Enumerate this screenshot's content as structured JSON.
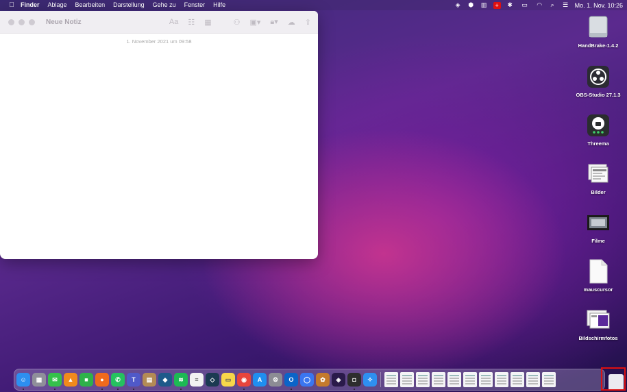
{
  "menubar": {
    "app_name": "Finder",
    "items": [
      "Ablage",
      "Bearbeiten",
      "Darstellung",
      "Gehe zu",
      "Fenster",
      "Hilfe"
    ],
    "clock": "Mo. 1. Nov.  10:26"
  },
  "note": {
    "title": "Neue Notiz",
    "format_label": "Aa",
    "date": "1. November 2021 um 09:58"
  },
  "desktop_icons": [
    {
      "label": "HandBrake-1.4.2",
      "icon": "disk-image-icon"
    },
    {
      "label": "OBS-Studio 27.1.3",
      "icon": "obs-icon"
    },
    {
      "label": "Threema",
      "icon": "threema-icon"
    },
    {
      "label": "Bilder",
      "icon": "folder-images-icon"
    },
    {
      "label": "Filme",
      "icon": "folder-movies-icon"
    },
    {
      "label": "mauscursor",
      "icon": "document-icon"
    },
    {
      "label": "Bildschirmfotos",
      "icon": "screenshots-folder-icon"
    }
  ],
  "dock": {
    "apps": [
      {
        "name": "finder-icon",
        "color": "#2d8ff0",
        "glyph": "☺"
      },
      {
        "name": "launchpad-icon",
        "color": "#8f8f9a",
        "glyph": "▦"
      },
      {
        "name": "messages-icon",
        "color": "#35c14b",
        "glyph": "✉"
      },
      {
        "name": "vlc-icon",
        "color": "#f08a1c",
        "glyph": "▲"
      },
      {
        "name": "facetime-icon",
        "color": "#2fb14a",
        "glyph": "■"
      },
      {
        "name": "firefox-icon",
        "color": "#f06a1c",
        "glyph": "●"
      },
      {
        "name": "whatsapp-icon",
        "color": "#25c25f",
        "glyph": "✆"
      },
      {
        "name": "teams-icon",
        "color": "#5059c9",
        "glyph": "T"
      },
      {
        "name": "notebook-icon",
        "color": "#b38b55",
        "glyph": "▤"
      },
      {
        "name": "app-store-alt-icon",
        "color": "#1e5a8a",
        "glyph": "◆"
      },
      {
        "name": "spotify-icon",
        "color": "#1db954",
        "glyph": "≋"
      },
      {
        "name": "reminders-icon",
        "color": "#f2f2f2",
        "glyph": "≡"
      },
      {
        "name": "affinity-icon",
        "color": "#1b3a52",
        "glyph": "◇"
      },
      {
        "name": "notes-icon",
        "color": "#f7d64a",
        "glyph": "▭"
      },
      {
        "name": "chrome-icon",
        "color": "#e8453c",
        "glyph": "◉"
      },
      {
        "name": "app-store-icon",
        "color": "#1f8ef0",
        "glyph": "A"
      },
      {
        "name": "system-preferences-icon",
        "color": "#8c8c94",
        "glyph": "⚙"
      },
      {
        "name": "outlook-icon",
        "color": "#0a64c8",
        "glyph": "O"
      },
      {
        "name": "signal-icon",
        "color": "#3a76f0",
        "glyph": "◯"
      },
      {
        "name": "cider-icon",
        "color": "#c47a2c",
        "glyph": "✿"
      },
      {
        "name": "premiere-icon",
        "color": "#2a1a4a",
        "glyph": "◈"
      },
      {
        "name": "threema-dock-icon",
        "color": "#2d2d2d",
        "glyph": "◘"
      },
      {
        "name": "safari-icon",
        "color": "#2e8ff0",
        "glyph": "✧"
      }
    ],
    "documents": 11
  }
}
